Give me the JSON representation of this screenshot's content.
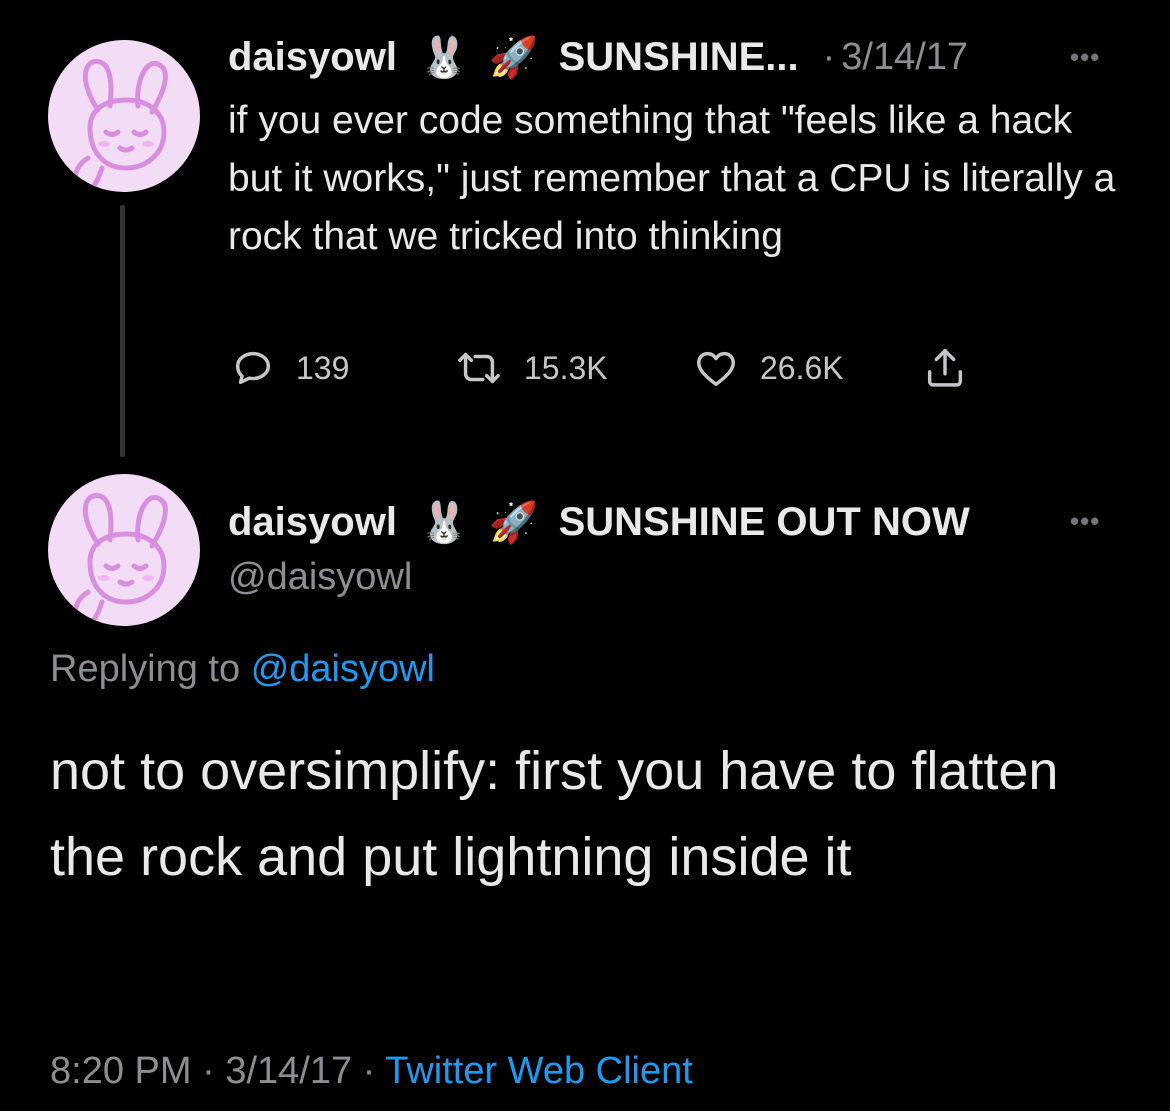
{
  "reply_to_tweet": {
    "display_name": "daisyowl",
    "name_emojis": [
      "🐰",
      "🚀"
    ],
    "name_suffix": "SUNSHINE...",
    "separator": "·",
    "date": "3/14/17",
    "more_label": "•••",
    "text": "if you ever code something that \"feels like a hack but it works,\" just remember that a CPU is literally a rock that we tricked into thinking",
    "actions": {
      "replies": "139",
      "retweets": "15.3K",
      "likes": "26.6K"
    }
  },
  "main_tweet": {
    "display_name": "daisyowl",
    "name_emojis": [
      "🐰",
      "🚀"
    ],
    "name_suffix": "SUNSHINE OUT NOW",
    "handle": "@daisyowl",
    "more_label": "•••",
    "replying_prefix": "Replying to",
    "replying_handle": "@daisyowl",
    "text": "not to oversimplify: first you have to flatten the rock and put lightning inside it",
    "time": "8:20 PM",
    "separator": "·",
    "date": "3/14/17",
    "client": "Twitter Web Client"
  },
  "icons": {
    "avatar": "bunny-avatar-icon",
    "reply": "reply-icon",
    "retweet": "retweet-icon",
    "like": "heart-icon",
    "share": "share-icon"
  },
  "colors": {
    "background": "#000000",
    "text": "#e7e9ea",
    "muted": "#71767b",
    "link": "#1d9bf0",
    "avatar_bg": "#f3dcf6",
    "avatar_line": "#d98fe0"
  }
}
